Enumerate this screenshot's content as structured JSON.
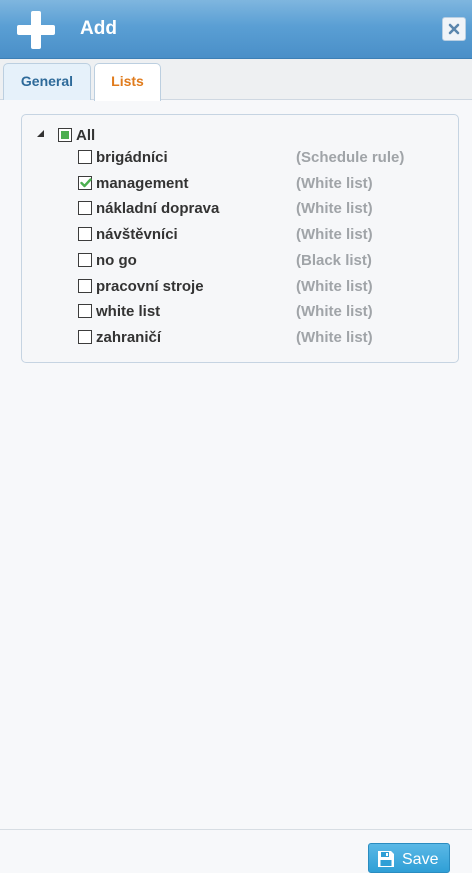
{
  "header": {
    "title": "Add",
    "icon": "plus-icon",
    "close_icon": "close-icon"
  },
  "tabs": [
    {
      "label": "General",
      "active": false
    },
    {
      "label": "Lists",
      "active": true
    }
  ],
  "tree": {
    "root_label": "All",
    "root_state": "partial",
    "items": [
      {
        "name": "brigádníci",
        "type": "(Schedule rule)",
        "checked": false
      },
      {
        "name": "management",
        "type": "(White list)",
        "checked": true
      },
      {
        "name": "nákladní doprava",
        "type": "(White list)",
        "checked": false
      },
      {
        "name": "návštěvníci",
        "type": "(White list)",
        "checked": false
      },
      {
        "name": "no go",
        "type": "(Black list)",
        "checked": false
      },
      {
        "name": "pracovní stroje",
        "type": "(White list)",
        "checked": false
      },
      {
        "name": "white list",
        "type": "(White list)",
        "checked": false
      },
      {
        "name": "zahraničí",
        "type": "(White list)",
        "checked": false
      }
    ]
  },
  "footer": {
    "save_label": "Save",
    "save_icon": "floppy-disk-icon"
  },
  "colors": {
    "header": "#5a9fd4",
    "accent_tab": "#e07b1c",
    "check": "#4caf50",
    "save": "#2f9fd6"
  }
}
